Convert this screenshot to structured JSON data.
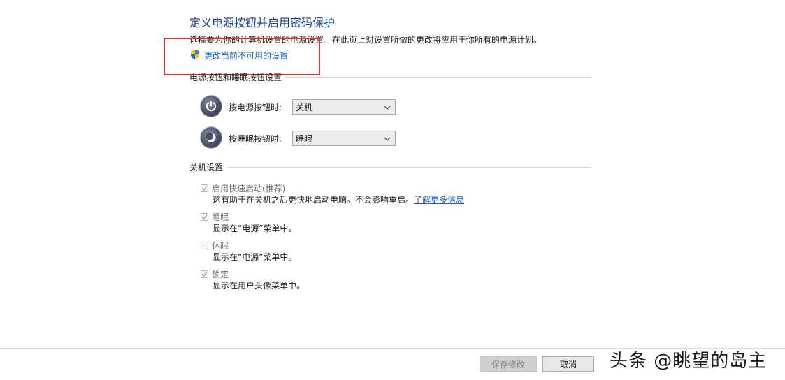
{
  "header": {
    "title": "定义电源按钮并启用密码保护",
    "description": "选择要为你的计算机设置的电源设置。在此页上对设置所做的更改将应用于你所有的电源计划。",
    "change_settings_link": "更改当前不可用的设置"
  },
  "power_button_section": {
    "heading": "电源按钮和睡眠按钮设置",
    "rows": [
      {
        "label": "按电源按钮时:",
        "value": "关机"
      },
      {
        "label": "按睡眠按钮时:",
        "value": "睡眠"
      }
    ]
  },
  "shutdown_section": {
    "heading": "关机设置",
    "options": [
      {
        "label": "启用快速启动(推荐)",
        "checked": true,
        "desc": "这有助于在关机之后更快地启动电脑。不会影响重启。",
        "link": "了解更多信息"
      },
      {
        "label": "睡眠",
        "checked": true,
        "desc": "显示在“电源”菜单中。"
      },
      {
        "label": "休眠",
        "checked": false,
        "desc": "显示在“电源”菜单中。"
      },
      {
        "label": "锁定",
        "checked": true,
        "desc": "显示在用户头像菜单中。"
      }
    ]
  },
  "footer": {
    "save_label": "保存修改",
    "cancel_label": "取消"
  },
  "watermark": "头条 @眺望的岛主",
  "colors": {
    "title": "#1e3c8c",
    "link": "#1a5fb4",
    "highlight": "#e03030"
  },
  "icons": {
    "shield": "uac-shield-icon",
    "power": "power-icon",
    "sleep": "sleep-moon-icon",
    "dropdown": "chevron-down-icon",
    "check": "checkmark-icon"
  }
}
